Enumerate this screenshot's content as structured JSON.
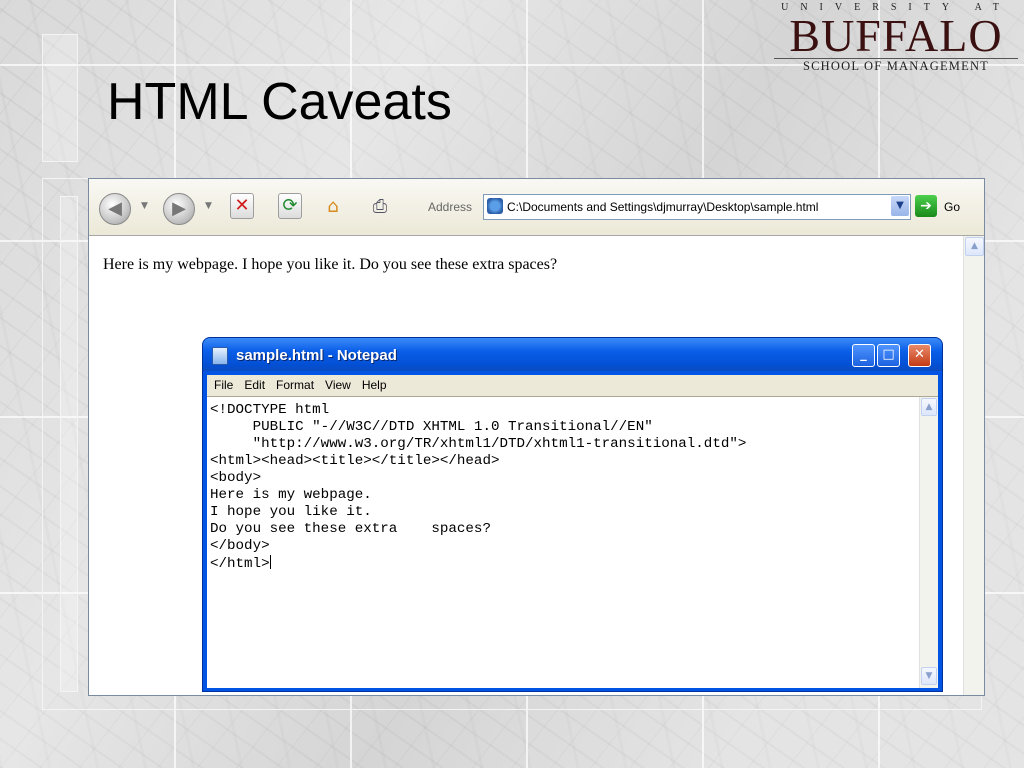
{
  "slide": {
    "title": "HTML Caveats"
  },
  "logo": {
    "top_line": "UNIVERSITY AT",
    "name": "BUFFALO",
    "subtitle": "SCHOOL OF MANAGEMENT"
  },
  "browser": {
    "back_glyph": "◀",
    "forward_glyph": "▶",
    "stop_glyph": "✕",
    "refresh_glyph": "⟳",
    "home_glyph": "⌂",
    "print_glyph": "⎙",
    "address_label": "Address",
    "address_value": "C:\\Documents and Settings\\djmurray\\Desktop\\sample.html",
    "address_dropdown_glyph": "▼",
    "go_glyph": "➔",
    "go_label": "Go",
    "page_text": "Here is my webpage. I hope you like it. Do you see these extra spaces?",
    "scroll_up_glyph": "▲"
  },
  "notepad": {
    "title": "sample.html - Notepad",
    "min_glyph": "_",
    "max_glyph": "□",
    "close_glyph": "✕",
    "menu": [
      "File",
      "Edit",
      "Format",
      "View",
      "Help"
    ],
    "text": "<!DOCTYPE html\n     PUBLIC \"-//W3C//DTD XHTML 1.0 Transitional//EN\"\n     \"http://www.w3.org/TR/xhtml1/DTD/xhtml1-transitional.dtd\">\n<html><head><title></title></head>\n<body>\nHere is my webpage.\nI hope you like it.\nDo you see these extra    spaces?\n</body>\n</html>",
    "scroll_up_glyph": "▲",
    "scroll_down_glyph": "▼"
  }
}
